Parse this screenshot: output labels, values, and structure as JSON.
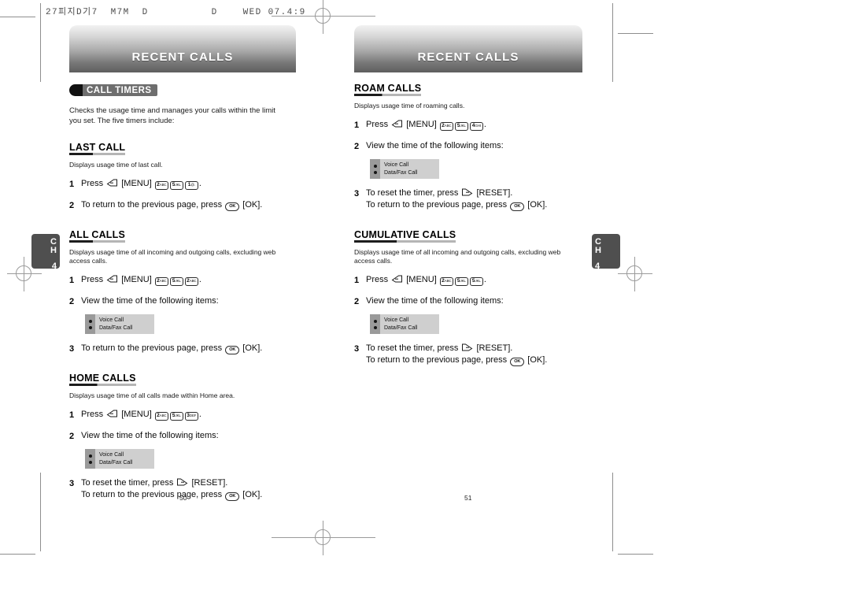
{
  "print_header": "27피지D기7  M7M  D          D    WED 07.4:9",
  "banner": {
    "left_title": "RECENT CALLS",
    "right_title": "RECENT CALLS"
  },
  "chapter_tab": {
    "letters": "CH",
    "number": "4"
  },
  "folio": {
    "left": "50",
    "right": "51"
  },
  "chip": {
    "label": "CALL TIMERS",
    "dot_icon": "bullet-icon"
  },
  "intro": "Checks the usage time and manages your calls within the limit you set. The five timers include:",
  "listbox": {
    "items": [
      "Voice Call",
      "Data/Fax Call"
    ],
    "bullet_icon": "bullet-icon",
    "bg_color": "#cfcfcf",
    "rail_color": "#9a9a9a"
  },
  "glyphs": {
    "menu_softkey": "left-softkey-icon",
    "reset_softkey": "right-softkey-icon",
    "ok_key": "ok-key-icon"
  },
  "keys": {
    "k2": {
      "digit": "2",
      "sub": "ABC"
    },
    "k5": {
      "digit": "5",
      "sub": "JKL"
    },
    "k1": {
      "digit": "1",
      "sub": "@."
    },
    "k3": {
      "digit": "3",
      "sub": "DEF"
    },
    "k4": {
      "digit": "4",
      "sub": "GHI"
    },
    "ok": {
      "digit": "OK"
    }
  },
  "labels": {
    "menu": "[MENU]",
    "ok": "[OK]",
    "reset": "[RESET]",
    "press": "Press",
    "period": "."
  },
  "sections": [
    {
      "id": "last-call",
      "title": "LAST CALL",
      "desc": "Displays usage time of last call.",
      "steps": [
        {
          "num": "1",
          "kind": "press",
          "pre": "Press",
          "keys": [
            "k2",
            "k5",
            "k1"
          ],
          "post": "."
        },
        {
          "num": "2",
          "kind": "ok-return",
          "lines": [
            "To return to the previous page, press "
          ],
          "tail": "[OK]."
        }
      ],
      "has_listbox": false
    },
    {
      "id": "all-calls",
      "title": "ALL CALLS",
      "desc": "Displays usage time of all incoming and outgoing calls, excluding web access calls.",
      "steps": [
        {
          "num": "1",
          "kind": "press",
          "pre": "Press",
          "keys": [
            "k2",
            "k5",
            "k2"
          ],
          "post": "."
        },
        {
          "num": "2",
          "kind": "view",
          "text": "View the time of the following items:"
        },
        {
          "num": "3",
          "kind": "ok-return",
          "lines": [
            "To return to the previous page, press "
          ],
          "tail": "[OK]."
        }
      ],
      "has_listbox": true,
      "listbox_after_step": "2"
    },
    {
      "id": "home-calls",
      "title": "HOME CALLS",
      "desc": "Displays usage time of all calls made within Home area.",
      "steps": [
        {
          "num": "1",
          "kind": "press",
          "pre": "Press",
          "keys": [
            "k2",
            "k5",
            "k3"
          ],
          "post": "."
        },
        {
          "num": "2",
          "kind": "view",
          "text": "View the time of the following items:"
        },
        {
          "num": "3",
          "kind": "reset-return",
          "line1": "To reset the timer, press ",
          "line1_tail": "[RESET].",
          "line2": "To return to the previous page, press ",
          "line2_tail": "[OK]."
        }
      ],
      "has_listbox": true,
      "listbox_after_step": "2"
    },
    {
      "id": "roam-calls",
      "title": "ROAM CALLS",
      "desc": "Displays usage time of roaming calls.",
      "steps": [
        {
          "num": "1",
          "kind": "press",
          "pre": "Press",
          "keys": [
            "k2",
            "k5",
            "k4"
          ],
          "post": "."
        },
        {
          "num": "2",
          "kind": "view",
          "text": "View the time of the following items:"
        },
        {
          "num": "3",
          "kind": "reset-return",
          "line1": "To reset the timer, press ",
          "line1_tail": "[RESET].",
          "line2": "To return to the previous page, press ",
          "line2_tail": "[OK]."
        }
      ],
      "has_listbox": true,
      "listbox_after_step": "2"
    },
    {
      "id": "cumulative-calls",
      "title": "CUMULATIVE CALLS",
      "desc": "Displays usage time of all incoming and outgoing calls, excluding web access calls.",
      "steps": [
        {
          "num": "1",
          "kind": "press",
          "pre": "Press",
          "keys": [
            "k2",
            "k5",
            "k5"
          ],
          "post": "."
        },
        {
          "num": "2",
          "kind": "view",
          "text": "View the time of the following items:"
        },
        {
          "num": "3",
          "kind": "reset-return",
          "line1": "To reset the timer, press ",
          "line1_tail": "[RESET].",
          "line2": "To return to the previous page, press ",
          "line2_tail": "[OK]."
        }
      ],
      "has_listbox": true,
      "listbox_after_step": "2"
    }
  ],
  "left_page_sections": [
    "last-call",
    "all-calls",
    "home-calls"
  ],
  "right_page_sections": [
    "roam-calls",
    "cumulative-calls"
  ]
}
